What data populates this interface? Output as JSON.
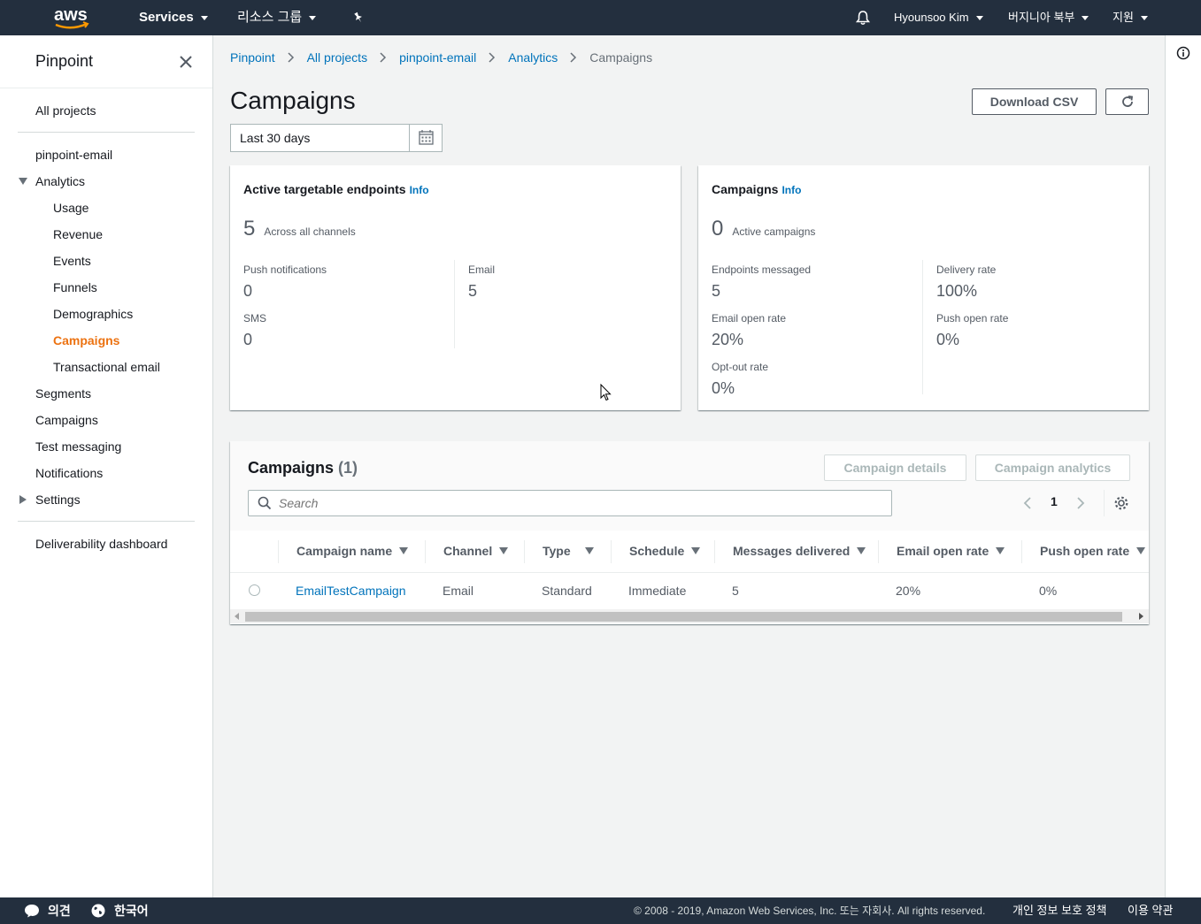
{
  "topbar": {
    "services": "Services",
    "resource_groups": "리소스 그룹",
    "user": "Hyounsoo Kim",
    "region": "버지니아 북부",
    "support": "지원"
  },
  "sidebar": {
    "title": "Pinpoint",
    "all_projects": "All projects",
    "project": "pinpoint-email",
    "analytics": "Analytics",
    "analytics_items": [
      "Usage",
      "Revenue",
      "Events",
      "Funnels",
      "Demographics",
      "Campaigns",
      "Transactional email"
    ],
    "segments": "Segments",
    "campaigns": "Campaigns",
    "test_messaging": "Test messaging",
    "notifications": "Notifications",
    "settings": "Settings",
    "deliverability": "Deliverability dashboard"
  },
  "breadcrumbs": [
    "Pinpoint",
    "All projects",
    "pinpoint-email",
    "Analytics",
    "Campaigns"
  ],
  "page": {
    "title": "Campaigns",
    "download_csv": "Download CSV",
    "date_range": "Last 30 days"
  },
  "endpoints_card": {
    "title": "Active targetable endpoints",
    "info": "Info",
    "total": "5",
    "total_label": "Across all channels",
    "push_label": "Push notifications",
    "push_value": "0",
    "sms_label": "SMS",
    "sms_value": "0",
    "email_label": "Email",
    "email_value": "5"
  },
  "campaigns_card": {
    "title": "Campaigns",
    "info": "Info",
    "total": "0",
    "total_label": "Active campaigns",
    "endpoints_label": "Endpoints messaged",
    "endpoints_value": "5",
    "email_open_label": "Email open rate",
    "email_open_value": "20%",
    "optout_label": "Opt-out rate",
    "optout_value": "0%",
    "delivery_label": "Delivery rate",
    "delivery_value": "100%",
    "push_open_label": "Push open rate",
    "push_open_value": "0%"
  },
  "table": {
    "title": "Campaigns",
    "count": "(1)",
    "details_btn": "Campaign details",
    "analytics_btn": "Campaign analytics",
    "search_placeholder": "Search",
    "page": "1",
    "columns": [
      "Campaign name",
      "Channel",
      "Type",
      "Schedule",
      "Messages delivered",
      "Email open rate",
      "Push open rate"
    ],
    "rows": [
      {
        "name": "EmailTestCampaign",
        "channel": "Email",
        "type": "Standard",
        "schedule": "Immediate",
        "delivered": "5",
        "email_open": "20%",
        "push_open": "0%"
      }
    ]
  },
  "footer": {
    "feedback": "의견",
    "language": "한국어",
    "copyright": "© 2008 - 2019, Amazon Web Services, Inc. 또는 자회사. All rights reserved.",
    "privacy": "개인 정보 보호 정책",
    "terms": "이용 약관"
  }
}
